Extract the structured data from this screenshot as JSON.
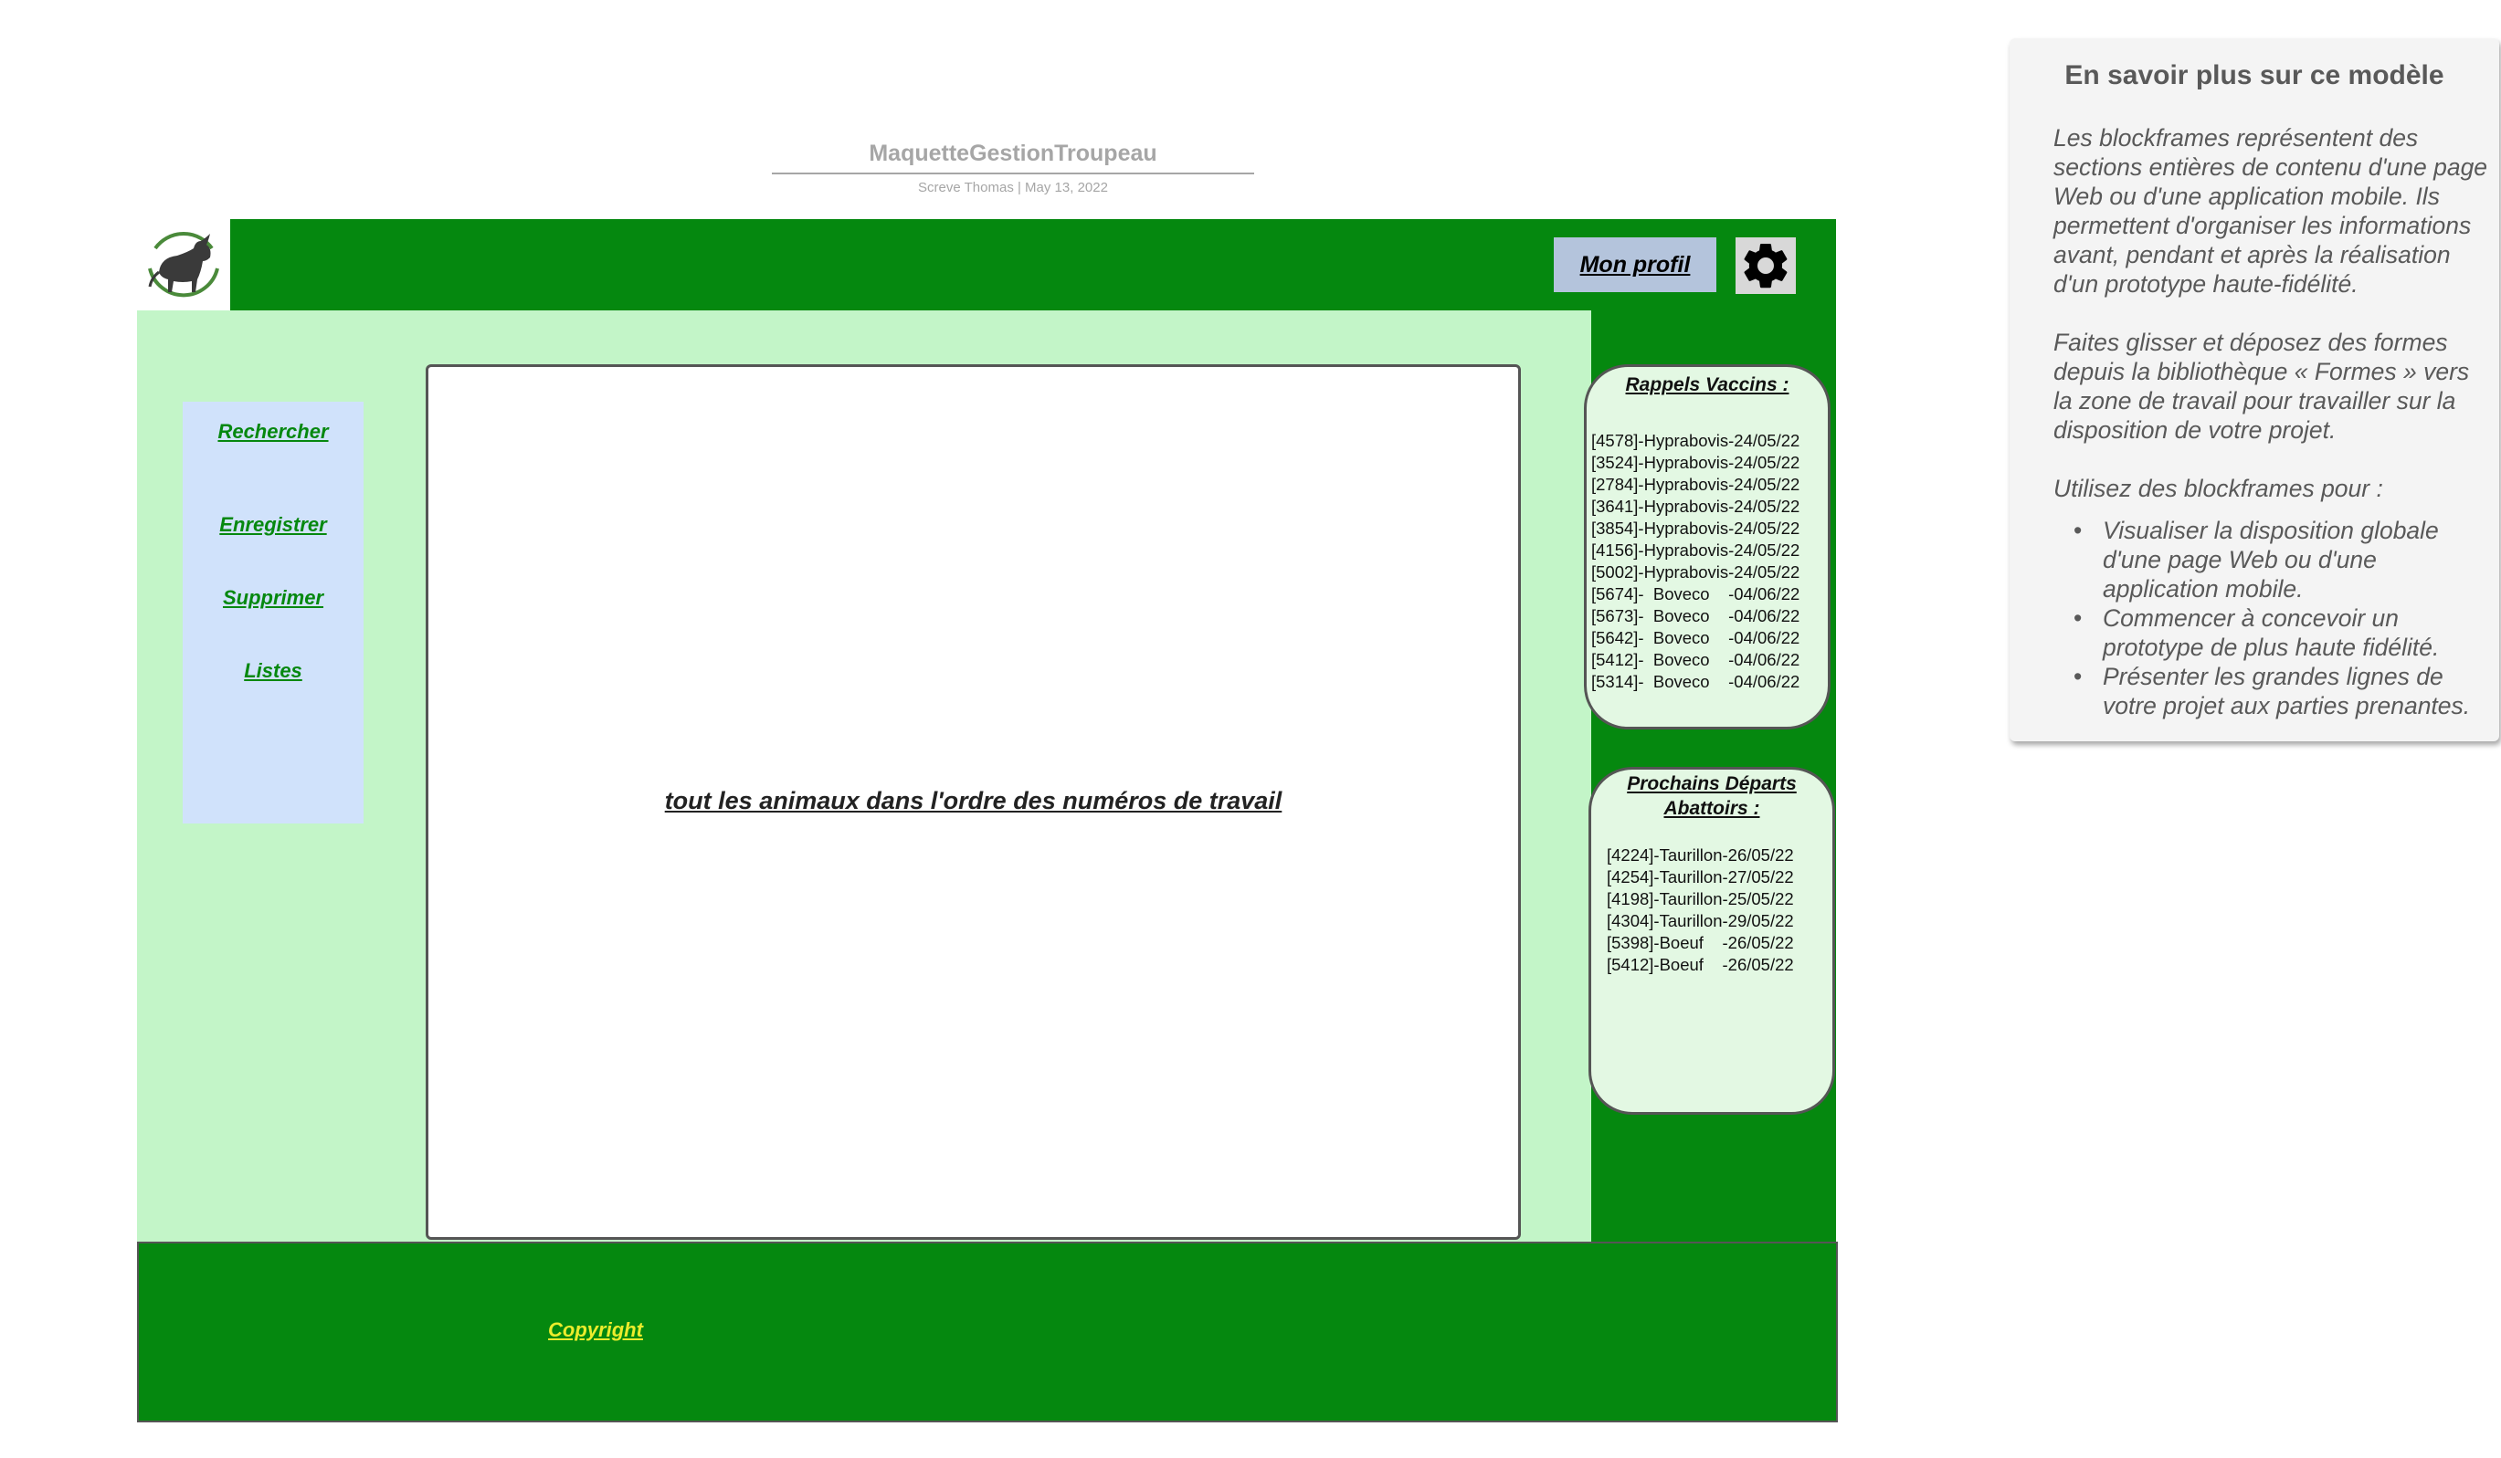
{
  "document": {
    "title": "MaquetteGestionTroupeau",
    "meta": "Screve Thomas  |  May 13, 2022"
  },
  "header": {
    "logo_icon": "bull-logo-icon",
    "profile_label": "Mon profil",
    "settings_icon": "gear-icon"
  },
  "sidebar": {
    "items": [
      {
        "label": "Rechercher"
      },
      {
        "label": "Enregistrer"
      },
      {
        "label": "Supprimer"
      },
      {
        "label": "Listes"
      }
    ]
  },
  "main": {
    "content_text": "tout les animaux dans l'ordre des numéros de travail"
  },
  "vaccins": {
    "title": "Rappels Vaccins :",
    "items": [
      "[4578]-Hyprabovis-24/05/22",
      "[3524]-Hyprabovis-24/05/22",
      "[2784]-Hyprabovis-24/05/22",
      "[3641]-Hyprabovis-24/05/22",
      "[3854]-Hyprabovis-24/05/22",
      "[4156]-Hyprabovis-24/05/22",
      "[5002]-Hyprabovis-24/05/22",
      "[5674]-  Boveco    -04/06/22",
      "[5673]-  Boveco    -04/06/22",
      "[5642]-  Boveco    -04/06/22",
      "[5412]-  Boveco    -04/06/22",
      "[5314]-  Boveco    -04/06/22"
    ]
  },
  "departs": {
    "title_line1": "Prochains Départs",
    "title_line2": "Abattoirs :",
    "items": [
      "[4224]-Taurillon-26/05/22",
      "[4254]-Taurillon-27/05/22",
      "[4198]-Taurillon-25/05/22",
      "[4304]-Taurillon-29/05/22",
      "[5398]-Boeuf    -26/05/22",
      "[5412]-Boeuf    -26/05/22"
    ]
  },
  "footer": {
    "copyright": "Copyright"
  },
  "info_panel": {
    "title": "En savoir plus sur ce modèle",
    "paragraph1": "Les blockframes représentent des sections entières de contenu d'une page Web ou d'une application mobile. Ils permettent d'organiser les informations avant, pendant et après la réalisation d'un prototype haute-fidélité.",
    "paragraph2": "Faites glisser et déposez des formes depuis la bibliothèque « Formes » vers la zone de travail pour travailler sur la disposition de votre projet.",
    "paragraph3": "Utilisez des blockframes pour :",
    "bullets": [
      "Visualiser la disposition globale d'une page Web ou d'une application mobile.",
      "Commencer à concevoir un prototype de plus haute fidélité.",
      "Présenter les grandes lignes de votre projet aux parties prenantes."
    ]
  },
  "colors": {
    "brand_green": "#05880f",
    "main_bg": "#c3f5c8",
    "sidebar_bg": "#d0e2fb",
    "profile_bg": "#b4c4dc",
    "copyright_yellow": "#ecec2c"
  }
}
